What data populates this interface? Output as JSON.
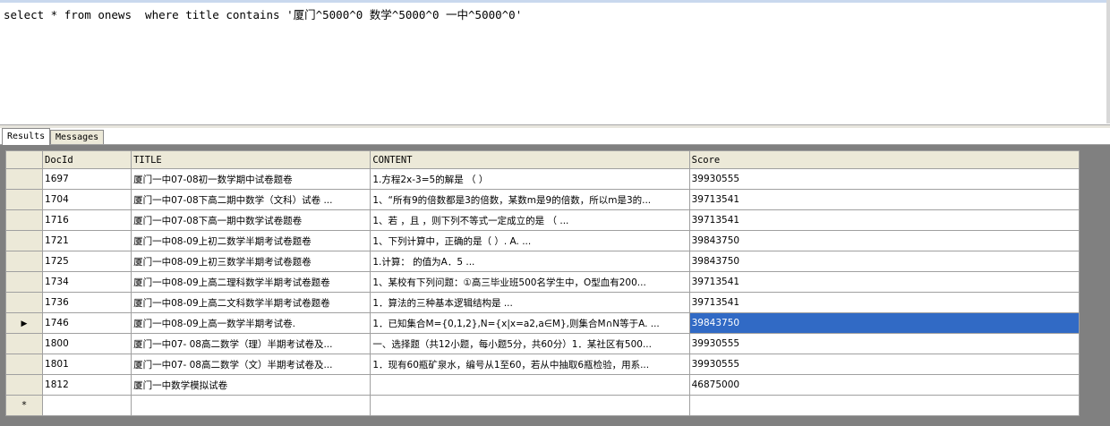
{
  "editor": {
    "query": "select * from onews  where title contains '厦门^5000^0 数学^5000^0 一中^5000^0'"
  },
  "tabs": [
    {
      "label": "Results",
      "active": true
    },
    {
      "label": "Messages",
      "active": false
    }
  ],
  "grid": {
    "columns": [
      "DocId",
      "TITLE",
      "CONTENT",
      "Score"
    ],
    "rows": [
      {
        "docid": "1697",
        "title": "厦门一中07-08初一数学期中试卷题卷",
        "content": "1.方程2x-3=5的解是   （   ）",
        "score": "39930555"
      },
      {
        "docid": "1704",
        "title": "厦门一中07-08下高二期中数学（文科）试卷 ...",
        "content": "1、“所有9的倍数都是3的倍数，某数m是9的倍数，所以m是3的...",
        "score": "39713541"
      },
      {
        "docid": "1716",
        "title": "厦门一中07-08下高一期中数学试卷题卷",
        "content": "1、若  ，且  ，则下列不等式一定成立的是              （     ...",
        "score": "39713541"
      },
      {
        "docid": "1721",
        "title": "厦门一中08-09上初二数学半期考试卷题卷",
        "content": "1、下列计算中，正确的是（     ）. A.   ...",
        "score": "39843750"
      },
      {
        "docid": "1725",
        "title": "厦门一中08-09上初三数学半期考试卷题卷",
        "content": "1.计算：  的值为A．5 ...",
        "score": "39843750"
      },
      {
        "docid": "1734",
        "title": "厦门一中08-09上高二理科数学半期考试卷题卷",
        "content": "1、某校有下列问题：①高三毕业班500名学生中，O型血有200...",
        "score": "39713541"
      },
      {
        "docid": "1736",
        "title": "厦门一中08-09上高二文科数学半期考试卷题卷",
        "content": "1．算法的三种基本逻辑结构是                               ...",
        "score": "39713541"
      },
      {
        "docid": "1746",
        "title": "厦门一中08-09上高一数学半期考试卷.",
        "content": "1．已知集合M={0,1,2},N={x|x=a2,a∈M},则集合M∩N等于A.   ...",
        "score": "39843750"
      },
      {
        "docid": "1800",
        "title": "厦门一中07- 08高二数学（理）半期考试卷及...",
        "content": "一、选择题（共12小题，每小题5分，共60分）1．某社区有500...",
        "score": "39930555"
      },
      {
        "docid": "1801",
        "title": "厦门一中07- 08高二数学（文）半期考试卷及...",
        "content": "1．现有60瓶矿泉水，编号从1至60，若从中抽取6瓶检验，用系...",
        "score": "39930555"
      },
      {
        "docid": "1812",
        "title": "厦门一中数学模拟试卷",
        "content": "",
        "score": "46875000"
      }
    ],
    "current_row_marker": "▶",
    "new_row_marker": "*",
    "selection_color": "#316ac5"
  }
}
